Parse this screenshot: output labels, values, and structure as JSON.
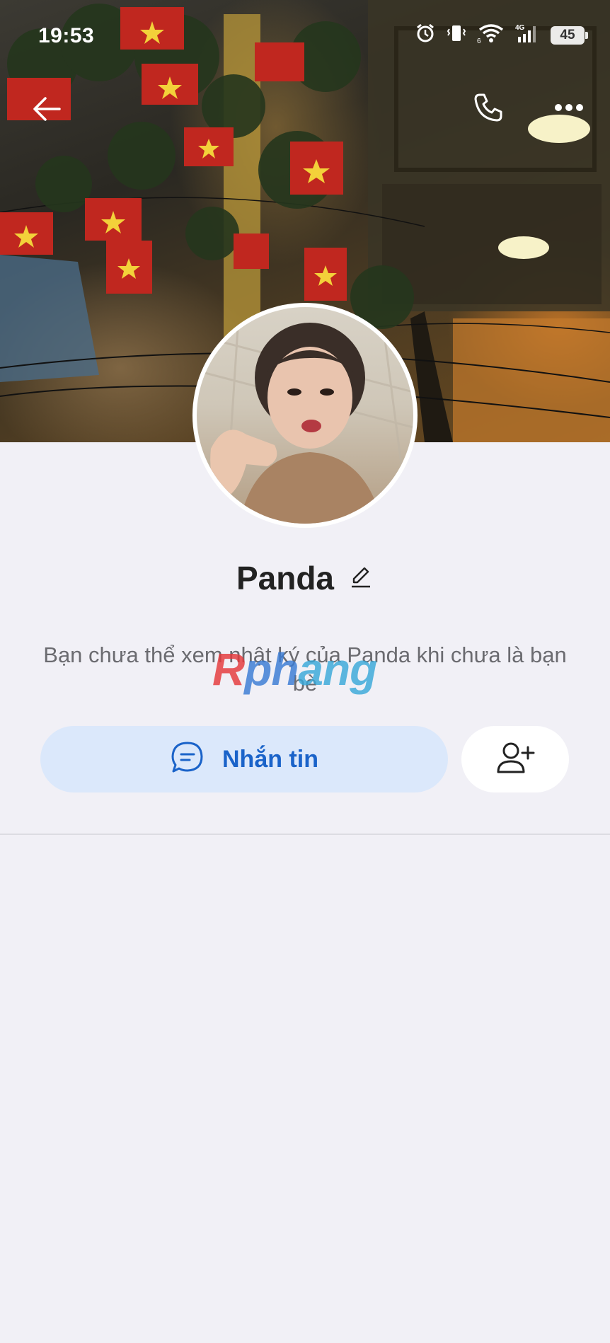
{
  "status_bar": {
    "time": "19:53",
    "battery": "45",
    "icons": [
      "alarm-icon",
      "vibrate-icon",
      "wifi-icon",
      "cellular-4g-icon",
      "battery-icon"
    ]
  },
  "top_nav": {
    "icons": [
      "back-arrow-icon",
      "phone-icon",
      "more-options-icon"
    ]
  },
  "profile": {
    "name": "Panda",
    "notice": "Bạn chưa thể xem nhật ký của Panda khi chưa là bạn bè"
  },
  "watermark": {
    "part_a": "R",
    "part_b": "ph",
    "part_c": "ang"
  },
  "actions": {
    "message_label": "Nhắn tin",
    "message_icon": "chat-bubble-icon",
    "add_friend_icon": "add-friend-icon"
  },
  "colors": {
    "background": "#f1f0f6",
    "message_button_bg": "#dbe8fb",
    "accent": "#1a63c9",
    "text_primary": "#222222",
    "text_secondary": "#6b6b70"
  }
}
